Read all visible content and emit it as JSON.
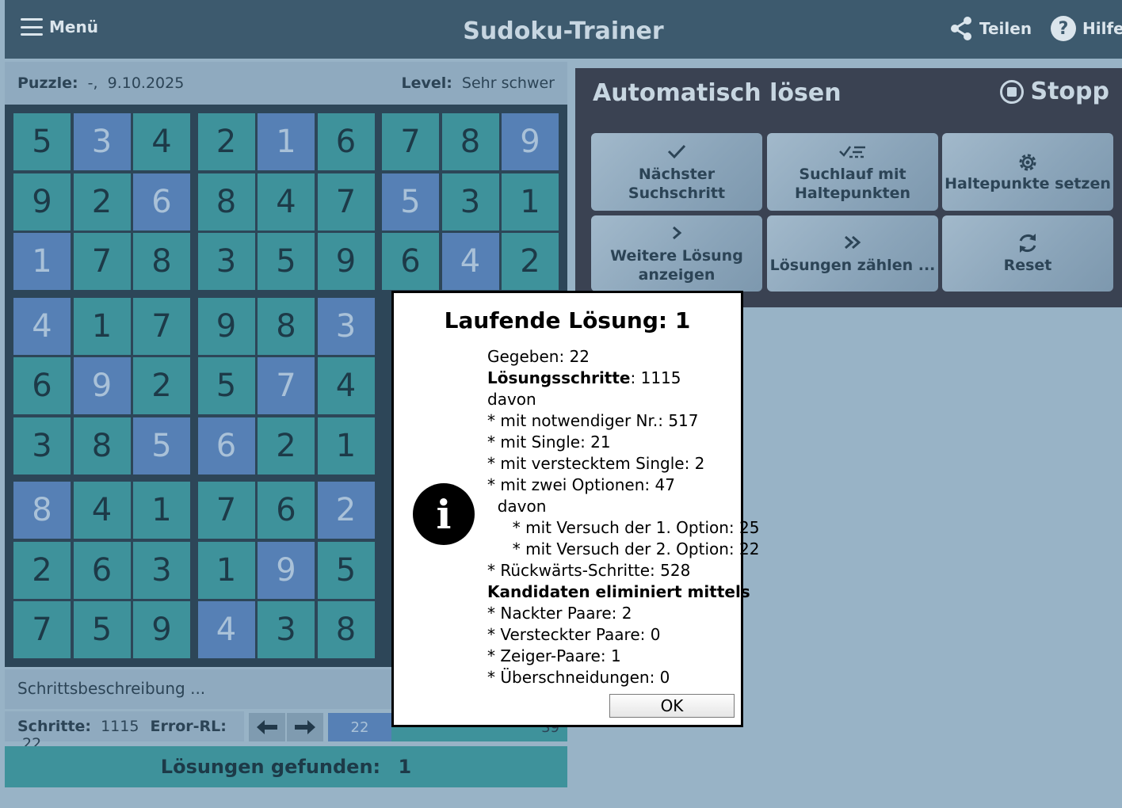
{
  "header": {
    "menu_label": "Menü",
    "title": "Sudoku-Trainer",
    "share_label": "Teilen",
    "help_label": "Hilfe"
  },
  "info": {
    "puzzle_label": "Puzzle:",
    "puzzle_value": "-,  9.10.2025",
    "level_label": "Level:",
    "level_value": "Sehr schwer"
  },
  "board": {
    "rows": [
      [
        "5",
        "3",
        "4",
        "2",
        "1",
        "6",
        "7",
        "8",
        "9"
      ],
      [
        "9",
        "2",
        "6",
        "8",
        "4",
        "7",
        "5",
        "3",
        "1"
      ],
      [
        "1",
        "7",
        "8",
        "3",
        "5",
        "9",
        "6",
        "4",
        "2"
      ],
      [
        "4",
        "1",
        "7",
        "9",
        "8",
        "3",
        "",
        "",
        ""
      ],
      [
        "6",
        "9",
        "2",
        "5",
        "7",
        "4",
        "",
        "",
        ""
      ],
      [
        "3",
        "8",
        "5",
        "6",
        "2",
        "1",
        "",
        "",
        ""
      ],
      [
        "8",
        "4",
        "1",
        "7",
        "6",
        "2",
        "",
        "",
        ""
      ],
      [
        "2",
        "6",
        "3",
        "1",
        "9",
        "5",
        "",
        "",
        ""
      ],
      [
        "7",
        "5",
        "9",
        "4",
        "3",
        "8",
        "",
        "",
        ""
      ]
    ],
    "styles": [
      [
        "t",
        "b",
        "t",
        "t",
        "b",
        "t",
        "t",
        "t",
        "b"
      ],
      [
        "t",
        "t",
        "b",
        "t",
        "t",
        "t",
        "b",
        "t",
        "t"
      ],
      [
        "b",
        "t",
        "t",
        "t",
        "t",
        "t",
        "t",
        "b",
        "t"
      ],
      [
        "b",
        "t",
        "t",
        "t",
        "t",
        "b",
        "",
        "",
        ""
      ],
      [
        "t",
        "b",
        "t",
        "t",
        "b",
        "t",
        "",
        "",
        ""
      ],
      [
        "t",
        "t",
        "b",
        "b",
        "t",
        "t",
        "",
        "",
        ""
      ],
      [
        "b",
        "t",
        "t",
        "t",
        "t",
        "b",
        "",
        "",
        ""
      ],
      [
        "t",
        "t",
        "t",
        "t",
        "b",
        "t",
        "",
        "",
        ""
      ],
      [
        "t",
        "t",
        "t",
        "b",
        "t",
        "t",
        "",
        "",
        ""
      ]
    ],
    "colors": {
      "teal": "#3e929b",
      "blue": "#5680b5"
    }
  },
  "step_description": "Schrittsbeschreibung ...",
  "bottom": {
    "steps_label": "Schritte:",
    "steps_value": "1115",
    "error_label": "Error-RL:",
    "error_value": "22",
    "range_value": "22",
    "range_max": "39",
    "solutions_label": "Lösungen gefunden:",
    "solutions_value": "1"
  },
  "panel": {
    "title": "Automatisch lösen",
    "stop_label": "Stopp",
    "buttons": [
      {
        "label": "Nächster Suchschritt",
        "icon": "check-icon"
      },
      {
        "label": "Suchlauf mit Haltepunkten",
        "icon": "checklist-icon"
      },
      {
        "label": "Haltepunkte setzen",
        "icon": "gear-icon"
      },
      {
        "label": "Weitere Lösung anzeigen",
        "icon": "chevron-right-icon"
      },
      {
        "label": "Lösungen zählen ...",
        "icon": "double-chevron-right-icon"
      },
      {
        "label": "Reset",
        "icon": "refresh-icon"
      }
    ]
  },
  "dialog": {
    "title": "Laufende Lösung: 1",
    "lines": [
      {
        "text": "Gegeben: 22"
      },
      {
        "bold": "Lösungsschritte",
        "text": ": 1115"
      },
      {
        "text": "davon"
      },
      {
        "text": "* mit notwendiger Nr.: 517"
      },
      {
        "text": "* mit Single: 21"
      },
      {
        "text": "* mit verstecktem Single: 2"
      },
      {
        "text": "* mit zwei Optionen: 47"
      },
      {
        "text": "  davon"
      },
      {
        "text": "     * mit Versuch der 1. Option: 25"
      },
      {
        "text": "     * mit Versuch der 2. Option: 22"
      },
      {
        "text": "* Rückwärts-Schritte: 528"
      },
      {
        "bold": "Kandidaten eliminiert mittels",
        "text": ""
      },
      {
        "text": "* Nackter Paare: 2"
      },
      {
        "text": "* Versteckter Paare: 0"
      },
      {
        "text": "* Zeiger-Paare: 1"
      },
      {
        "text": "* Überschneidungen: 0"
      }
    ],
    "ok_label": "OK"
  }
}
